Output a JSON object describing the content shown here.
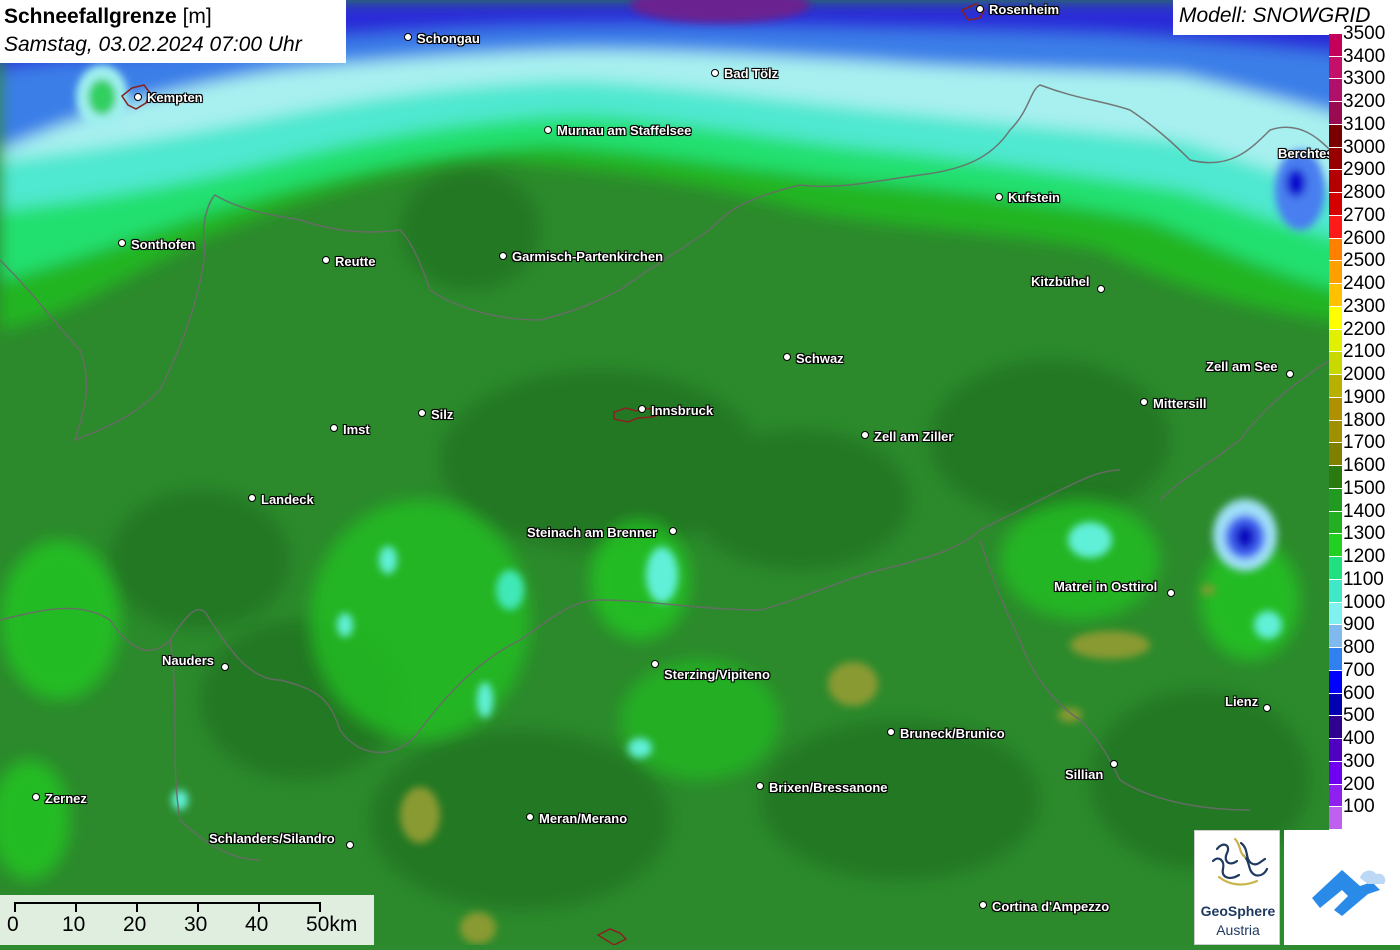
{
  "title": {
    "variable": "Schneefallgrenze",
    "unit": "[m]",
    "date": "Samstag, 03.02.2024 07:00 Uhr"
  },
  "model": "Modell: SNOWGRID",
  "cities": [
    {
      "name": "Schongau"
    },
    {
      "name": "Rosenheim"
    },
    {
      "name": "Kempten"
    },
    {
      "name": "Bad Tölz"
    },
    {
      "name": "Murnau am Staffelsee"
    },
    {
      "name": "Berchtesgaden"
    },
    {
      "name": "Kufstein"
    },
    {
      "name": "Sonthofen"
    },
    {
      "name": "Reutte"
    },
    {
      "name": "Garmisch-Partenkirchen"
    },
    {
      "name": "Kitzbühel"
    },
    {
      "name": "Schwaz"
    },
    {
      "name": "Zell am See"
    },
    {
      "name": "Mittersill"
    },
    {
      "name": "Silz"
    },
    {
      "name": "Innsbruck"
    },
    {
      "name": "Imst"
    },
    {
      "name": "Zell am Ziller"
    },
    {
      "name": "Landeck"
    },
    {
      "name": "Steinach am Brenner"
    },
    {
      "name": "Matrei in Osttirol"
    },
    {
      "name": "Nauders"
    },
    {
      "name": "Sterzing/Vipiteno"
    },
    {
      "name": "Lienz"
    },
    {
      "name": "Bruneck/Brunico"
    },
    {
      "name": "Sillian"
    },
    {
      "name": "Brixen/Bressanone"
    },
    {
      "name": "Zernez"
    },
    {
      "name": "Meran/Merano"
    },
    {
      "name": "Schlanders/Silandro"
    },
    {
      "name": "Cortina d'Ampezzo"
    }
  ],
  "legend": [
    {
      "label": "3500",
      "color": "#c4005a"
    },
    {
      "label": "3400",
      "color": "#c4106a"
    },
    {
      "label": "3300",
      "color": "#b0106a"
    },
    {
      "label": "3200",
      "color": "#9a0a50"
    },
    {
      "label": "3100",
      "color": "#7a0000"
    },
    {
      "label": "3000",
      "color": "#980000"
    },
    {
      "label": "2900",
      "color": "#b40000"
    },
    {
      "label": "2800",
      "color": "#d40000"
    },
    {
      "label": "2700",
      "color": "#ff1a1a"
    },
    {
      "label": "2600",
      "color": "#ff8000"
    },
    {
      "label": "2500",
      "color": "#ffa000"
    },
    {
      "label": "2400",
      "color": "#ffc000"
    },
    {
      "label": "2300",
      "color": "#ffff00"
    },
    {
      "label": "2200",
      "color": "#e0f000"
    },
    {
      "label": "2100",
      "color": "#c8d800"
    },
    {
      "label": "2000",
      "color": "#b8b000"
    },
    {
      "label": "1900",
      "color": "#b09000"
    },
    {
      "label": "1800",
      "color": "#a09000"
    },
    {
      "label": "1700",
      "color": "#808000"
    },
    {
      "label": "1600",
      "color": "#2a7a10"
    },
    {
      "label": "1500",
      "color": "#209a20"
    },
    {
      "label": "1400",
      "color": "#22b022"
    },
    {
      "label": "1300",
      "color": "#22d022"
    },
    {
      "label": "1200",
      "color": "#20e080"
    },
    {
      "label": "1100",
      "color": "#40e8c8"
    },
    {
      "label": "1000",
      "color": "#80f0f0"
    },
    {
      "label": "900",
      "color": "#80b8f0"
    },
    {
      "label": "800",
      "color": "#3080f0"
    },
    {
      "label": "700",
      "color": "#0000ff"
    },
    {
      "label": "600",
      "color": "#0000b0"
    },
    {
      "label": "500",
      "color": "#300090"
    },
    {
      "label": "400",
      "color": "#5000c0"
    },
    {
      "label": "300",
      "color": "#7000f0"
    },
    {
      "label": "200",
      "color": "#9020f0"
    },
    {
      "label": "100",
      "color": "#c060f0"
    }
  ],
  "scale": {
    "labels": [
      "0",
      "10",
      "20",
      "30",
      "40",
      "50km"
    ]
  },
  "logos": {
    "geosphere_line1": "GeoSphere",
    "geosphere_line2": "Austria"
  }
}
